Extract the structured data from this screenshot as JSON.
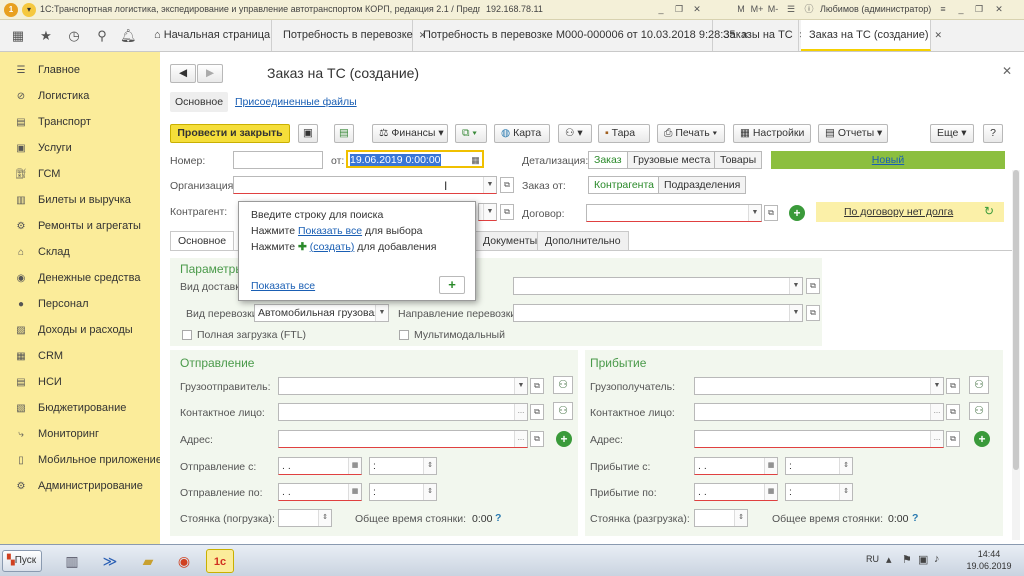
{
  "window": {
    "title": "1С:Транспортная логистика, экспедирование и управление автотранспортом КОРП, редакция 2.1 / Предприятие",
    "ip": "192.168.78.11",
    "user": "Любимов (администратор)",
    "controls": [
      "M",
      "M+",
      "M-"
    ]
  },
  "tabs": [
    {
      "label": "Начальная страница"
    },
    {
      "label": "Потребность в перевозке"
    },
    {
      "label": "Потребность в перевозке М000-000006 от 10.03.2018 9:28:35"
    },
    {
      "label": "Заказы на ТС"
    },
    {
      "label": "Заказ на ТС (создание)"
    }
  ],
  "sidebar": {
    "items": [
      {
        "label": "Главное",
        "icon": "list-icon"
      },
      {
        "label": "Логистика",
        "icon": "logistics-icon"
      },
      {
        "label": "Транспорт",
        "icon": "truck-icon"
      },
      {
        "label": "Услуги",
        "icon": "services-icon"
      },
      {
        "label": "ГСМ",
        "icon": "fuel-icon"
      },
      {
        "label": "Билеты и выручка",
        "icon": "ticket-icon"
      },
      {
        "label": "Ремонты и агрегаты",
        "icon": "wrench-icon"
      },
      {
        "label": "Склад",
        "icon": "warehouse-icon"
      },
      {
        "label": "Денежные средства",
        "icon": "money-icon"
      },
      {
        "label": "Персонал",
        "icon": "person-icon"
      },
      {
        "label": "Доходы и расходы",
        "icon": "chart-icon"
      },
      {
        "label": "CRM",
        "icon": "crm-icon"
      },
      {
        "label": "НСИ",
        "icon": "reference-icon"
      },
      {
        "label": "Бюджетирование",
        "icon": "budget-icon"
      },
      {
        "label": "Мониторинг",
        "icon": "monitoring-icon"
      },
      {
        "label": "Мобильное приложение",
        "icon": "mobile-icon"
      },
      {
        "label": "Администрирование",
        "icon": "admin-icon"
      }
    ]
  },
  "form": {
    "title": "Заказ на ТС (создание)",
    "subtabs": [
      "Основное",
      "Присоединенные файлы"
    ],
    "toolbar": {
      "post_close": "Провести и закрыть",
      "finance": "Финансы",
      "map": "Карта",
      "tara": "Тара",
      "print": "Печать",
      "settings": "Настройки",
      "reports": "Отчеты",
      "more": "Еще",
      "help": "?"
    },
    "number_label": "Номер:",
    "number_value": "",
    "from_label": "от:",
    "date_value": "19.06.2019  0:00:00",
    "detail_label": "Детализация:",
    "detail_options": [
      "Заказ",
      "Грузовые места",
      "Товары"
    ],
    "status": "Новый",
    "org_label": "Организация:",
    "order_from_label": "Заказ от:",
    "order_from_options": [
      "Контрагента",
      "Подразделения"
    ],
    "contractor_label": "Контрагент:",
    "contract_label": "Договор:",
    "debt_text": "По договору нет долга",
    "form_tabs": [
      "Основное",
      "Документы",
      "Дополнительно"
    ],
    "params_title": "Параметры",
    "delivery_label": "Вид доставки:",
    "transport_type_label": "Вид перевозки:",
    "transport_type_value": "Автомобильная грузовая",
    "direction_label": "Направление перевозки:",
    "ftl_label": "Полная загрузка (FTL)",
    "multimodal_label": "Мультимодальный",
    "departure": {
      "title": "Отправление",
      "shipper_label": "Грузоотправитель:",
      "contact_label": "Контактное лицо:",
      "address_label": "Адрес:",
      "from_label": "Отправление с:",
      "to_label": "Отправление по:",
      "date_placeholder": " .  .",
      "time_placeholder": "  :",
      "parking_label": "Стоянка (погрузка):",
      "total_label": "Общее время стоянки:",
      "total_value": "0:00"
    },
    "arrival": {
      "title": "Прибытие",
      "consignee_label": "Грузополучатель:",
      "contact_label": "Контактное лицо:",
      "address_label": "Адрес:",
      "from_label": "Прибытие с:",
      "to_label": "Прибытие по:",
      "date_placeholder": " .  .",
      "time_placeholder": "  :",
      "parking_label": "Стоянка (разгрузка):",
      "total_label": "Общее время стоянки:",
      "total_value": "0:00"
    }
  },
  "popup": {
    "line1": "Введите строку для поиска",
    "line2_pre": "Нажмите ",
    "line2_link": "Показать все",
    "line2_post": " для выбора",
    "line3_pre": "Нажмите ",
    "line3_link": "(создать)",
    "line3_post": " для добавления",
    "show_all": "Показать все"
  },
  "taskbar": {
    "start": "Пуск",
    "lang": "RU",
    "time": "14:44",
    "date": "19.06.2019"
  },
  "colors": {
    "accent": "#f5de3a",
    "sidebar": "#fbec9a",
    "green": "#4a9a4a",
    "status": "#8cbf3f"
  }
}
